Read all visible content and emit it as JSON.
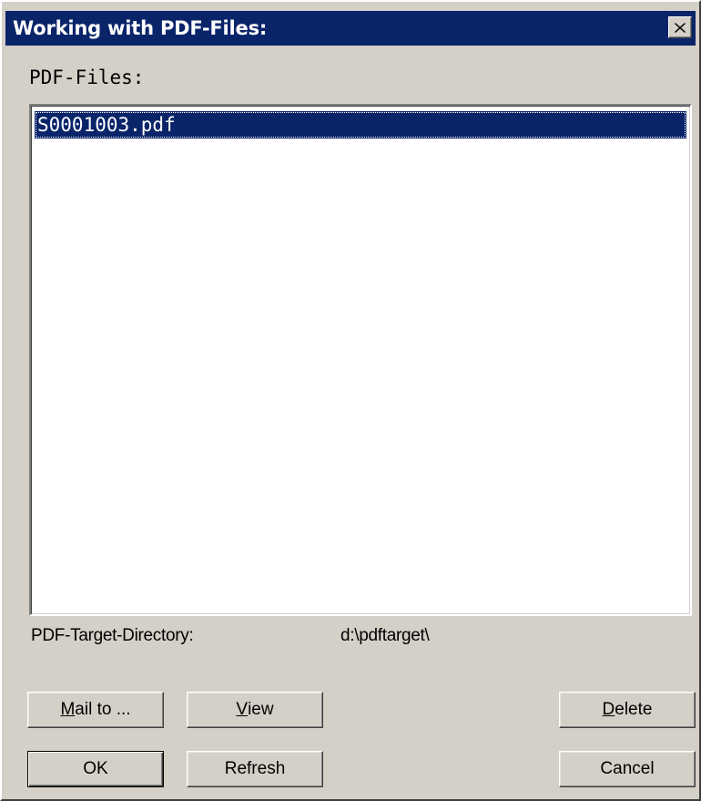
{
  "window": {
    "title": "Working with PDF-Files:",
    "close_icon": "close-icon"
  },
  "files": {
    "label": "PDF-Files:",
    "items": [
      {
        "name": "S0001003.pdf",
        "selected": true
      }
    ]
  },
  "target_directory": {
    "label": "PDF-Target-Directory:",
    "value": "d:\\pdftarget\\"
  },
  "buttons": {
    "mail_to": {
      "access_key": "M",
      "rest": "ail to ..."
    },
    "view": {
      "access_key": "V",
      "rest": "iew"
    },
    "delete": {
      "access_key": "D",
      "rest": "elete"
    },
    "ok": {
      "label": "OK"
    },
    "refresh": {
      "label": "Refresh"
    },
    "cancel": {
      "label": "Cancel"
    }
  },
  "colors": {
    "face": "#d4d0c8",
    "titlebar": "#0a246a",
    "selection": "#0a246a"
  }
}
